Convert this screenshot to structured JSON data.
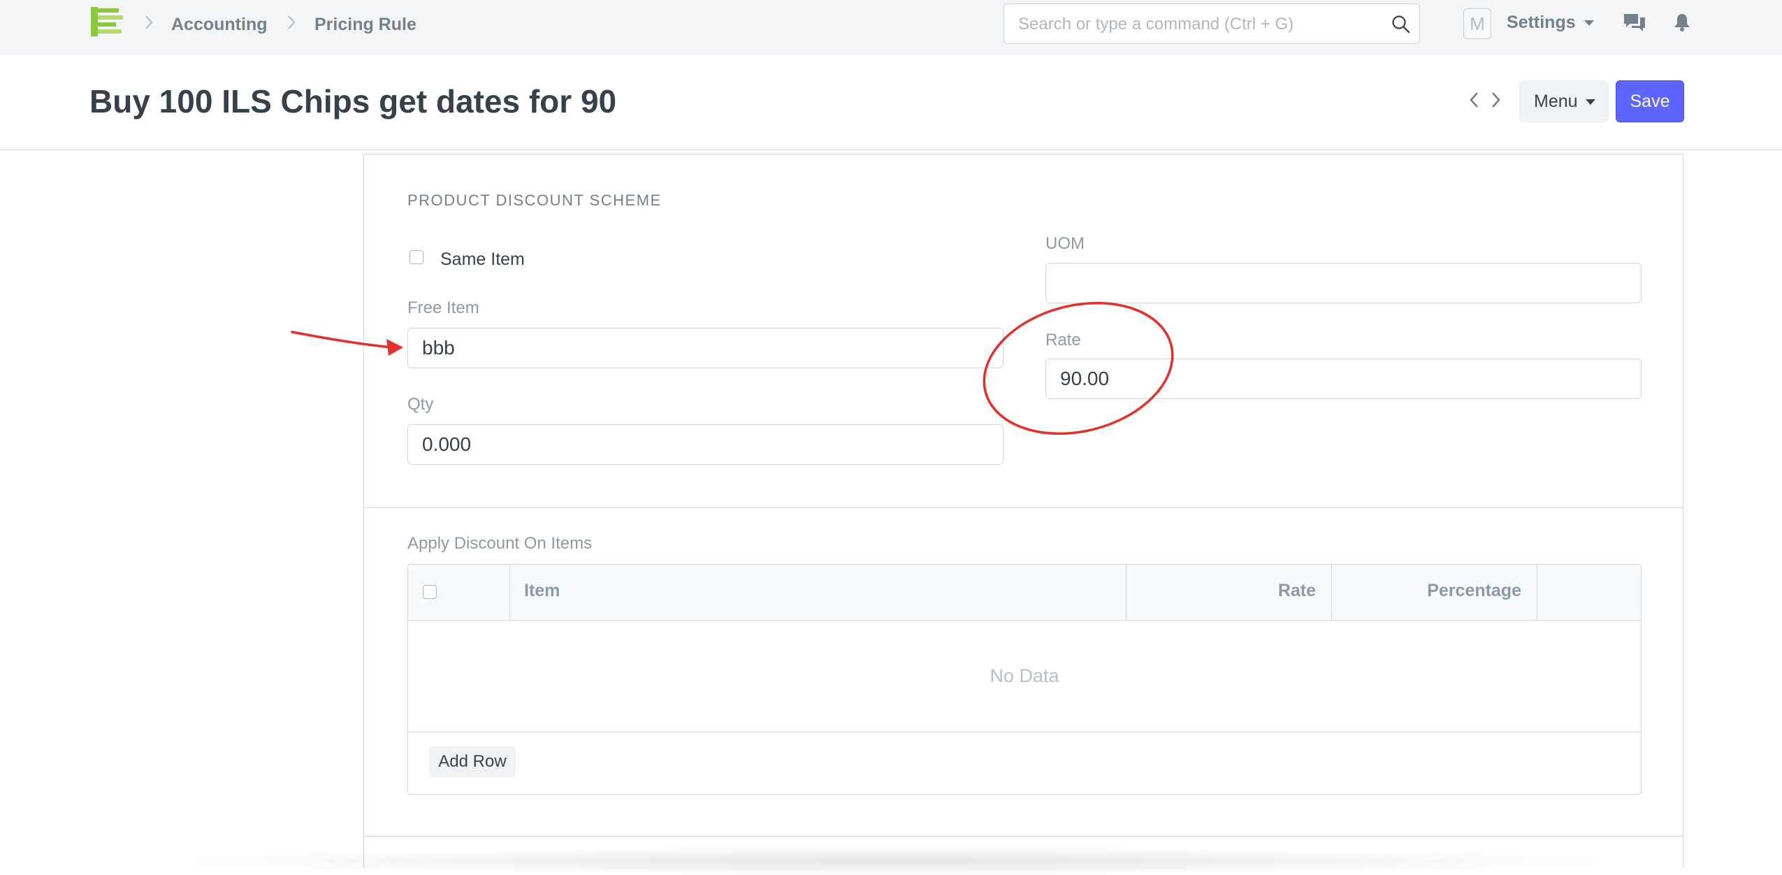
{
  "navbar": {
    "breadcrumbs": [
      "Accounting",
      "Pricing Rule"
    ],
    "search_placeholder": "Search or type a command (Ctrl + G)",
    "avatar_letter": "M",
    "settings_label": "Settings",
    "icons": [
      "app-logo",
      "chevron-right-icon",
      "search-icon",
      "caret-down-icon",
      "chat-icon",
      "bell-icon"
    ]
  },
  "page": {
    "title": "Buy 100 ILS Chips get dates for 90",
    "menu_label": "Menu",
    "save_label": "Save",
    "accent_color": "#5e64ff"
  },
  "product_discount": {
    "section_title": "PRODUCT DISCOUNT SCHEME",
    "same_item_label": "Same Item",
    "same_item_checked": false,
    "free_item_label": "Free Item",
    "free_item_value": "bbb",
    "qty_label": "Qty",
    "qty_value": "0.000",
    "uom_label": "UOM",
    "uom_value": "",
    "rate_label": "Rate",
    "rate_value": "90.00"
  },
  "apply_discount": {
    "label": "Apply Discount On Items",
    "columns": [
      "Item",
      "Rate",
      "Percentage"
    ],
    "empty_text": "No Data",
    "add_row_label": "Add Row"
  },
  "annotations": {
    "color": "#e3302a",
    "shapes": [
      "arrow pointing to Free Item field",
      "ellipse around Rate field"
    ]
  }
}
